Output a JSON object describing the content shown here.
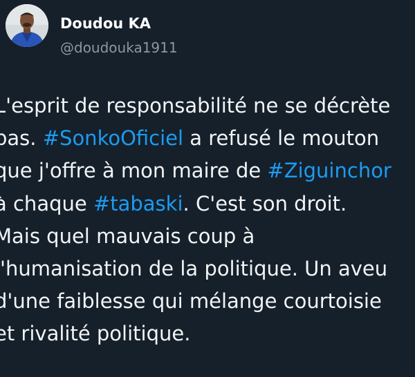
{
  "author": {
    "display_name": "Doudou KA",
    "handle": "@doudouka1911"
  },
  "tweet": {
    "lines": [
      {
        "segments": [
          {
            "text": "L'esprit de responsabilité ne se décrète",
            "type": "text"
          }
        ]
      },
      {
        "segments": [
          {
            "text": "pas. ",
            "type": "text"
          },
          {
            "text": "#SonkoOficiel",
            "type": "hashtag"
          },
          {
            "text": " a refusé le mouton",
            "type": "text"
          }
        ]
      },
      {
        "segments": [
          {
            "text": "que j'offre à mon maire de ",
            "type": "text"
          },
          {
            "text": "#Ziguinchor",
            "type": "hashtag"
          }
        ]
      },
      {
        "segments": [
          {
            "text": "à chaque ",
            "type": "text"
          },
          {
            "text": "#tabaski",
            "type": "hashtag"
          },
          {
            "text": ". C'est son droit.",
            "type": "text"
          }
        ]
      },
      {
        "segments": [
          {
            "text": "Mais quel mauvais coup à",
            "type": "text"
          }
        ]
      },
      {
        "segments": [
          {
            "text": "l'humanisation de la politique. Un aveu",
            "type": "text"
          }
        ]
      },
      {
        "segments": [
          {
            "text": "d'une faiblesse qui mélange courtoisie",
            "type": "text"
          }
        ]
      },
      {
        "segments": [
          {
            "text": "et rivalité politique.",
            "type": "text"
          }
        ]
      }
    ]
  },
  "colors": {
    "background": "#15202b",
    "hashtag": "#1d9bf0",
    "handle": "#8b98a5"
  },
  "avatar_icon": "profile-photo"
}
